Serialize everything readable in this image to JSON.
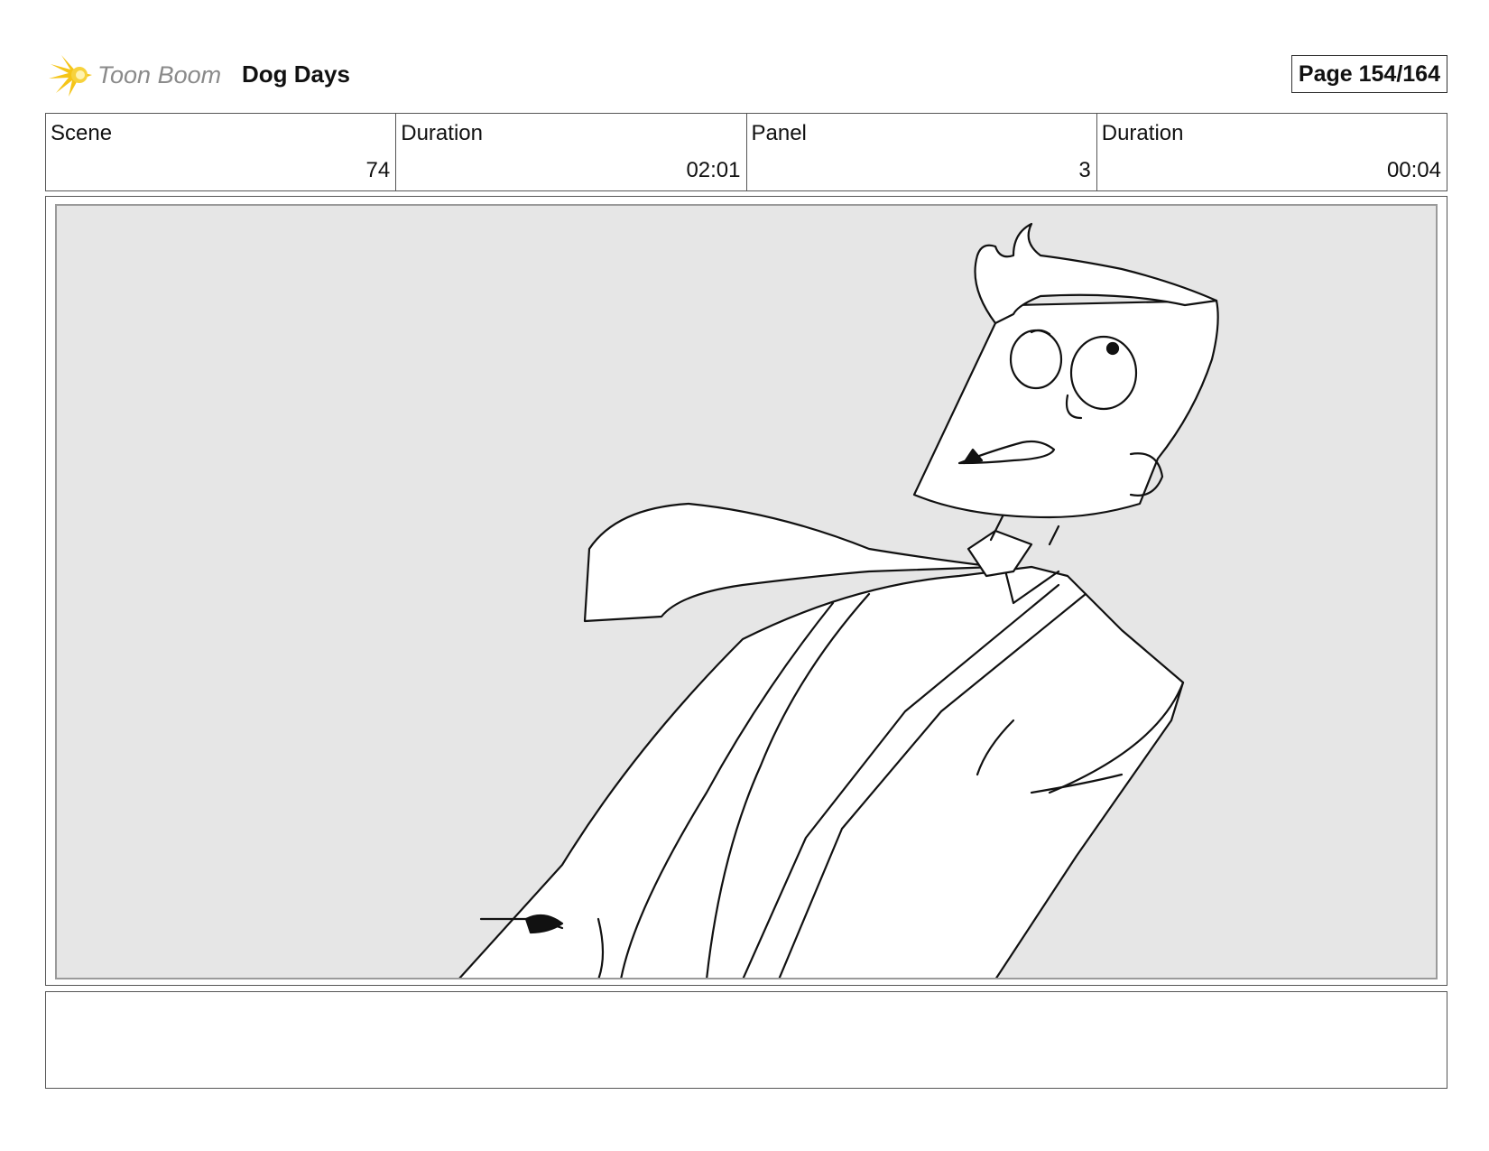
{
  "header": {
    "logo_text": "Toon Boom",
    "project_title": "Dog Days",
    "page_label": "Page 154/164"
  },
  "info": {
    "scene_label": "Scene",
    "scene_value": "74",
    "scene_duration_label": "Duration",
    "scene_duration_value": "02:01",
    "panel_label": "Panel",
    "panel_value": "3",
    "panel_duration_label": "Duration",
    "panel_duration_value": "00:04"
  },
  "panel": {
    "drawing": "storyboard-sketch-character-icon",
    "background_color": "#e6e6e6"
  },
  "notes": {
    "text": ""
  },
  "colors": {
    "logo_flare": "#f5c518",
    "logo_text": "#8a8a8a",
    "border": "#555555"
  }
}
